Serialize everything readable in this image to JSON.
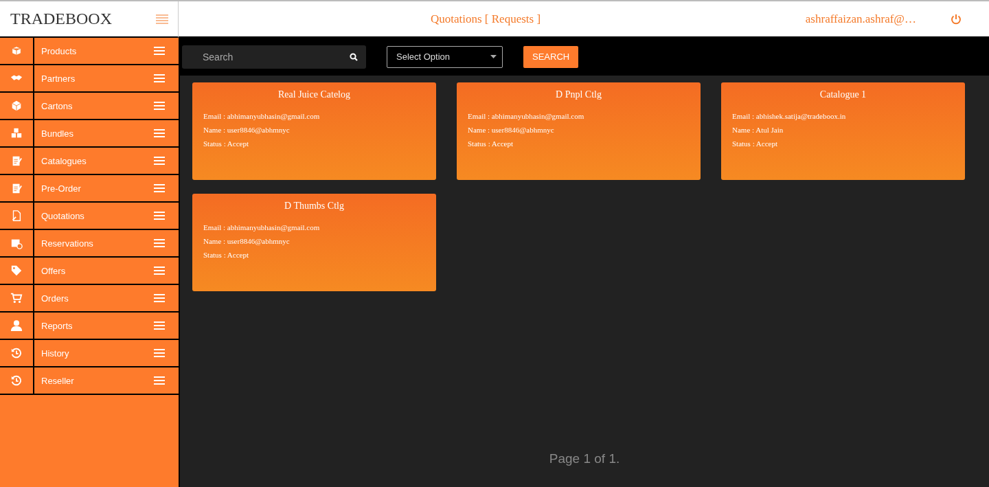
{
  "brand": "TRADEBOOX",
  "header": {
    "title": "Quotations [ Requests ]",
    "user": "ashraffaizan.ashraf@…"
  },
  "sidebar": {
    "items": [
      {
        "label": "Products"
      },
      {
        "label": "Partners"
      },
      {
        "label": "Cartons"
      },
      {
        "label": "Bundles"
      },
      {
        "label": "Catalogues"
      },
      {
        "label": "Pre-Order"
      },
      {
        "label": "Quotations"
      },
      {
        "label": "Reservations"
      },
      {
        "label": "Offers"
      },
      {
        "label": "Orders"
      },
      {
        "label": "Reports"
      },
      {
        "label": "History"
      },
      {
        "label": "Reseller"
      }
    ]
  },
  "toolbar": {
    "search_placeholder": "Search",
    "select_placeholder": "Select Option",
    "search_button": "SEARCH"
  },
  "cards": [
    {
      "title": "Real Juice Catelog",
      "lines": [
        "Email : abhimanyubhasin@gmail.com",
        "Name : user8846@abhmnyc",
        "Status : Accept"
      ]
    },
    {
      "title": "D Pnpl Ctlg",
      "lines": [
        "Email : abhimanyubhasin@gmail.com",
        "Name : user8846@abhmnyc",
        "Status : Accept"
      ]
    },
    {
      "title": "Catalogue 1",
      "lines": [
        "Email : abhishek.satija@tradeboox.in",
        "Name : Atul Jain",
        "Status : Accept"
      ]
    },
    {
      "title": "D Thumbs Ctlg",
      "lines": [
        "Email : abhimanyubhasin@gmail.com",
        "Name : user8846@abhmnyc",
        "Status : Accept"
      ]
    }
  ],
  "pagination": "Page 1 of 1."
}
